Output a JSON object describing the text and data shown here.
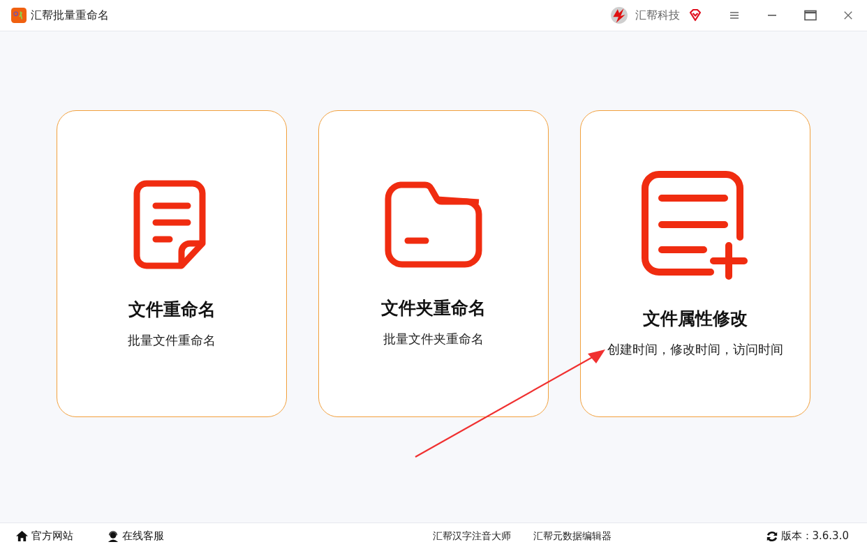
{
  "window": {
    "title": "汇帮批量重命名",
    "brand": "汇帮科技"
  },
  "cards": [
    {
      "kind": "file",
      "title": "文件重命名",
      "subtitle": "批量文件重命名"
    },
    {
      "kind": "folder",
      "title": "文件夹重命名",
      "subtitle": "批量文件夹重命名"
    },
    {
      "kind": "file-plus",
      "title": "文件属性修改",
      "subtitle": "创建时间，修改时间，访问时间"
    }
  ],
  "status_bar": {
    "links": [
      {
        "kind": "home",
        "label": "官方网站"
      },
      {
        "kind": "support",
        "label": "在线客服"
      }
    ],
    "apps": [
      "汇帮汉字注音大师",
      "汇帮元数据编辑器"
    ],
    "version": "版本：3.6.3.0"
  }
}
